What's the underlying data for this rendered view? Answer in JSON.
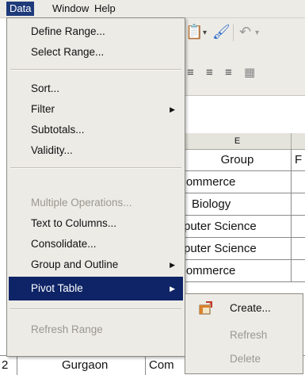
{
  "menubar": {
    "items": [
      {
        "label": "Data",
        "active": true
      },
      {
        "label": "Window"
      },
      {
        "label": "Help"
      }
    ]
  },
  "toolbar": {
    "icons": [
      "clipboard-icon",
      "chevron-down-icon",
      "paintbrush-icon",
      "undo-icon",
      "chevron-down-icon",
      "align-center-icon",
      "align-right-icon",
      "align-justify-icon",
      "table-icon"
    ]
  },
  "sheet": {
    "column_headers": [
      "E",
      ""
    ],
    "rows": [
      [
        "Group",
        "F"
      ],
      [
        "Commerce",
        ""
      ],
      [
        "Biology",
        ""
      ],
      [
        "puter Science",
        ""
      ],
      [
        "puter Science",
        ""
      ],
      [
        "Commerce",
        ""
      ]
    ],
    "bottom_row": [
      "2",
      "Gurgaon",
      "Com"
    ]
  },
  "data_menu": {
    "items": [
      {
        "label": "Define Range...",
        "enabled": true
      },
      {
        "label": "Select Range...",
        "enabled": true
      },
      {
        "label": "Sort...",
        "enabled": true
      },
      {
        "label": "Filter",
        "enabled": true,
        "submenu": true
      },
      {
        "label": "Subtotals...",
        "enabled": true
      },
      {
        "label": "Validity...",
        "enabled": true
      },
      {
        "label": "Multiple Operations...",
        "enabled": false
      },
      {
        "label": "Text to Columns...",
        "enabled": true
      },
      {
        "label": "Consolidate...",
        "enabled": true
      },
      {
        "label": "Group and Outline",
        "enabled": true,
        "submenu": true
      },
      {
        "label": "Pivot Table",
        "enabled": true,
        "submenu": true,
        "highlighted": true
      },
      {
        "label": "Refresh Range",
        "enabled": false
      }
    ]
  },
  "pivot_submenu": {
    "items": [
      {
        "label": "Create...",
        "enabled": true
      },
      {
        "label": "Refresh",
        "enabled": false
      },
      {
        "label": "Delete",
        "enabled": false
      }
    ]
  },
  "colors": {
    "menu_bg": "#ecebe6",
    "highlight": "#0e2466",
    "disabled_text": "#9a9890"
  }
}
